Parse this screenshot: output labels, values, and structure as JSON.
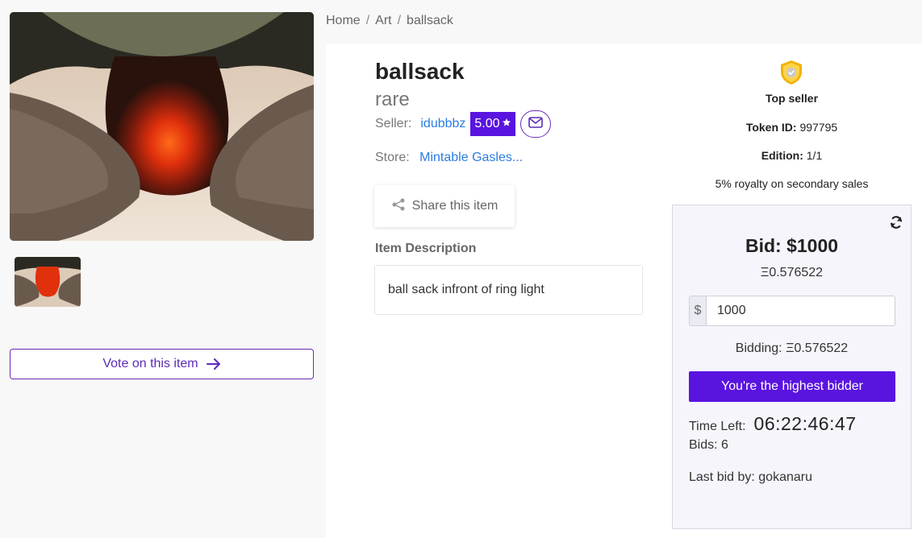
{
  "breadcrumb": {
    "home": "Home",
    "category": "Art",
    "current": "ballsack"
  },
  "item": {
    "title": "ballsack",
    "rarity": "rare",
    "seller_label": "Seller:",
    "seller_name": "idubbbz",
    "seller_rating": "5.00",
    "store_label": "Store:",
    "store_name": "Mintable Gasles...",
    "share_label": "Share this item",
    "description_heading": "Item Description",
    "description": "ball sack infront of ring light"
  },
  "vote": {
    "label": "Vote on this item"
  },
  "seller_badge": {
    "label": "Top seller"
  },
  "token": {
    "label": "Token ID:",
    "value": "997795"
  },
  "edition": {
    "label": "Edition:",
    "value": "1/1"
  },
  "royalty": {
    "text": "5% royalty on secondary sales"
  },
  "auction": {
    "bid_title": "Bid: $1000",
    "eth_value": "Ξ0.576522",
    "currency_prefix": "$",
    "input_value": "1000",
    "bidding_text": "Bidding: Ξ0.576522",
    "button_label": "You're the highest bidder",
    "time_label": "Time Left:",
    "time_value": "06:22:46:47",
    "bids_text": "Bids: 6",
    "last_bid_text": "Last bid by: gokanaru"
  },
  "colors": {
    "accent": "#5a14e0",
    "link": "#2b7de0",
    "badge_gold": "#f0b400"
  },
  "icons": [
    "arrow-right-icon",
    "star-icon",
    "mail-icon",
    "share-icon",
    "shield-check-icon",
    "refresh-icon"
  ]
}
